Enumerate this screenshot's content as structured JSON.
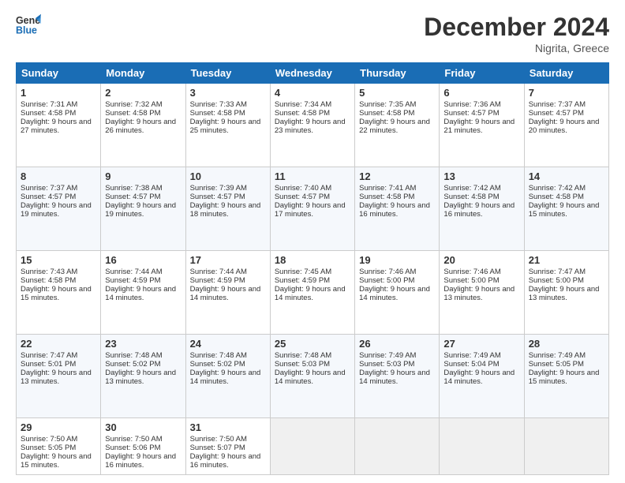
{
  "header": {
    "logo_line1": "General",
    "logo_line2": "Blue",
    "month": "December 2024",
    "location": "Nigrita, Greece"
  },
  "days_of_week": [
    "Sunday",
    "Monday",
    "Tuesday",
    "Wednesday",
    "Thursday",
    "Friday",
    "Saturday"
  ],
  "weeks": [
    [
      {
        "day": "1",
        "sunrise": "7:31 AM",
        "sunset": "4:58 PM",
        "daylight": "9 hours and 27 minutes."
      },
      {
        "day": "2",
        "sunrise": "7:32 AM",
        "sunset": "4:58 PM",
        "daylight": "9 hours and 26 minutes."
      },
      {
        "day": "3",
        "sunrise": "7:33 AM",
        "sunset": "4:58 PM",
        "daylight": "9 hours and 25 minutes."
      },
      {
        "day": "4",
        "sunrise": "7:34 AM",
        "sunset": "4:58 PM",
        "daylight": "9 hours and 23 minutes."
      },
      {
        "day": "5",
        "sunrise": "7:35 AM",
        "sunset": "4:58 PM",
        "daylight": "9 hours and 22 minutes."
      },
      {
        "day": "6",
        "sunrise": "7:36 AM",
        "sunset": "4:57 PM",
        "daylight": "9 hours and 21 minutes."
      },
      {
        "day": "7",
        "sunrise": "7:37 AM",
        "sunset": "4:57 PM",
        "daylight": "9 hours and 20 minutes."
      }
    ],
    [
      {
        "day": "8",
        "sunrise": "7:37 AM",
        "sunset": "4:57 PM",
        "daylight": "9 hours and 19 minutes."
      },
      {
        "day": "9",
        "sunrise": "7:38 AM",
        "sunset": "4:57 PM",
        "daylight": "9 hours and 19 minutes."
      },
      {
        "day": "10",
        "sunrise": "7:39 AM",
        "sunset": "4:57 PM",
        "daylight": "9 hours and 18 minutes."
      },
      {
        "day": "11",
        "sunrise": "7:40 AM",
        "sunset": "4:57 PM",
        "daylight": "9 hours and 17 minutes."
      },
      {
        "day": "12",
        "sunrise": "7:41 AM",
        "sunset": "4:58 PM",
        "daylight": "9 hours and 16 minutes."
      },
      {
        "day": "13",
        "sunrise": "7:42 AM",
        "sunset": "4:58 PM",
        "daylight": "9 hours and 16 minutes."
      },
      {
        "day": "14",
        "sunrise": "7:42 AM",
        "sunset": "4:58 PM",
        "daylight": "9 hours and 15 minutes."
      }
    ],
    [
      {
        "day": "15",
        "sunrise": "7:43 AM",
        "sunset": "4:58 PM",
        "daylight": "9 hours and 15 minutes."
      },
      {
        "day": "16",
        "sunrise": "7:44 AM",
        "sunset": "4:59 PM",
        "daylight": "9 hours and 14 minutes."
      },
      {
        "day": "17",
        "sunrise": "7:44 AM",
        "sunset": "4:59 PM",
        "daylight": "9 hours and 14 minutes."
      },
      {
        "day": "18",
        "sunrise": "7:45 AM",
        "sunset": "4:59 PM",
        "daylight": "9 hours and 14 minutes."
      },
      {
        "day": "19",
        "sunrise": "7:46 AM",
        "sunset": "5:00 PM",
        "daylight": "9 hours and 14 minutes."
      },
      {
        "day": "20",
        "sunrise": "7:46 AM",
        "sunset": "5:00 PM",
        "daylight": "9 hours and 13 minutes."
      },
      {
        "day": "21",
        "sunrise": "7:47 AM",
        "sunset": "5:00 PM",
        "daylight": "9 hours and 13 minutes."
      }
    ],
    [
      {
        "day": "22",
        "sunrise": "7:47 AM",
        "sunset": "5:01 PM",
        "daylight": "9 hours and 13 minutes."
      },
      {
        "day": "23",
        "sunrise": "7:48 AM",
        "sunset": "5:02 PM",
        "daylight": "9 hours and 13 minutes."
      },
      {
        "day": "24",
        "sunrise": "7:48 AM",
        "sunset": "5:02 PM",
        "daylight": "9 hours and 14 minutes."
      },
      {
        "day": "25",
        "sunrise": "7:48 AM",
        "sunset": "5:03 PM",
        "daylight": "9 hours and 14 minutes."
      },
      {
        "day": "26",
        "sunrise": "7:49 AM",
        "sunset": "5:03 PM",
        "daylight": "9 hours and 14 minutes."
      },
      {
        "day": "27",
        "sunrise": "7:49 AM",
        "sunset": "5:04 PM",
        "daylight": "9 hours and 14 minutes."
      },
      {
        "day": "28",
        "sunrise": "7:49 AM",
        "sunset": "5:05 PM",
        "daylight": "9 hours and 15 minutes."
      }
    ],
    [
      {
        "day": "29",
        "sunrise": "7:50 AM",
        "sunset": "5:05 PM",
        "daylight": "9 hours and 15 minutes."
      },
      {
        "day": "30",
        "sunrise": "7:50 AM",
        "sunset": "5:06 PM",
        "daylight": "9 hours and 16 minutes."
      },
      {
        "day": "31",
        "sunrise": "7:50 AM",
        "sunset": "5:07 PM",
        "daylight": "9 hours and 16 minutes."
      },
      null,
      null,
      null,
      null
    ]
  ]
}
